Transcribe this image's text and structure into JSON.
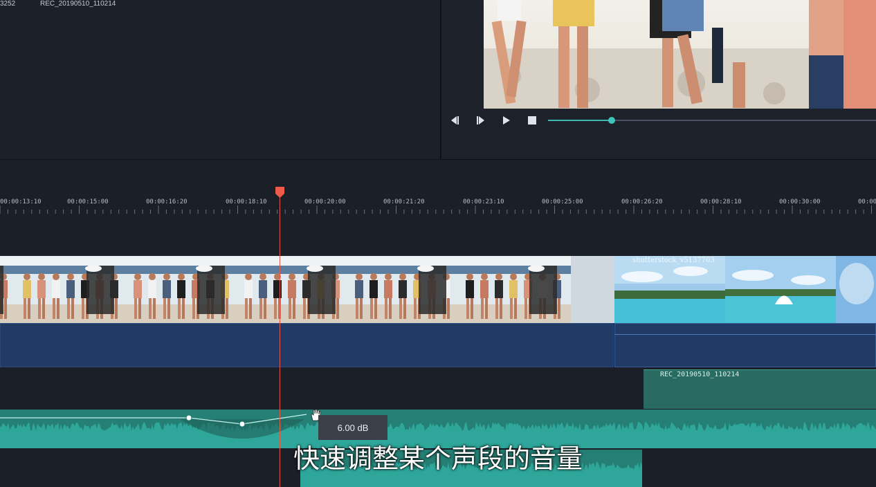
{
  "media": {
    "items": [
      {
        "label": "3252"
      },
      {
        "label": "REC_20190510_110214"
      }
    ]
  },
  "player": {
    "controls": [
      "prev-frame-icon",
      "next-frame-icon",
      "play-icon",
      "stop-icon"
    ],
    "progress_pct": 19
  },
  "ruler": {
    "ticks": [
      "00:00:13:10",
      "00:00:15:00",
      "00:00:16:20",
      "00:00:18:10",
      "00:00:20:00",
      "00:00:21:20",
      "00:00:23:10",
      "00:00:25:00",
      "00:00:26:20",
      "00:00:28:10",
      "00:00:30:00",
      "00:00"
    ]
  },
  "tracks": {
    "video_clip_2_label": "shutterstock_v5137703",
    "audio_clip_2_label": "REC_20190510_110214",
    "volume_tooltip": "6.00 dB"
  },
  "subtitle": "快速调整某个声段的音量",
  "colors": {
    "accent": "#3fb8b0",
    "audio": "#2ea69a",
    "playhead": "#e8594b",
    "video_audio": "#223b66"
  }
}
